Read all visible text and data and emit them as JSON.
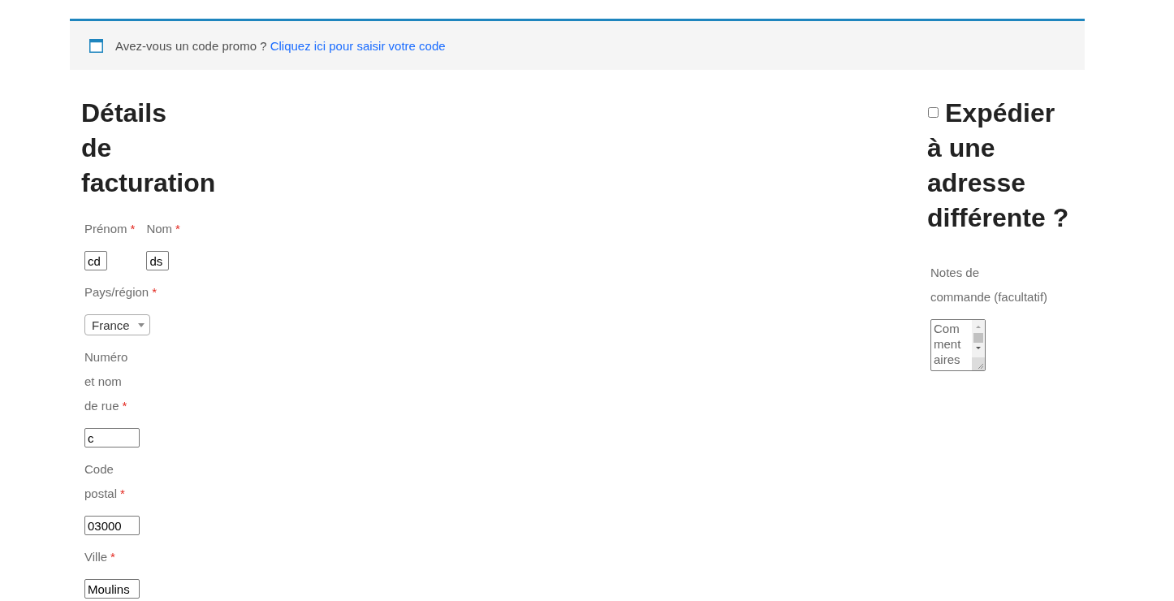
{
  "promo_notice": {
    "text": "Avez-vous un code promo ?",
    "link": "Cliquez ici pour saisir votre code"
  },
  "billing": {
    "title": "Détails de facturation",
    "name_fields": [
      {
        "label": "Prénom",
        "required_mark": "*",
        "value": "cd"
      },
      {
        "label": "Nom",
        "required_mark": "*",
        "value": "ds"
      }
    ],
    "fields": [
      {
        "kind": "select",
        "label": "Pays/région",
        "required_mark": "*",
        "value": "France"
      },
      {
        "kind": "text",
        "label": "Numéro et nom de rue",
        "required_mark": "*",
        "value": "c"
      },
      {
        "kind": "text",
        "label": "Code postal",
        "required_mark": "*",
        "value": "03000"
      },
      {
        "kind": "text",
        "label": "Ville",
        "required_mark": "*",
        "value": "Moulins"
      }
    ]
  },
  "shipping": {
    "checked": false,
    "title": "Expédier à une adresse différente ?"
  },
  "order_notes": {
    "label": "Notes de commande",
    "optional_mark": "(facultatif)",
    "placeholder": "Commentaires"
  }
}
